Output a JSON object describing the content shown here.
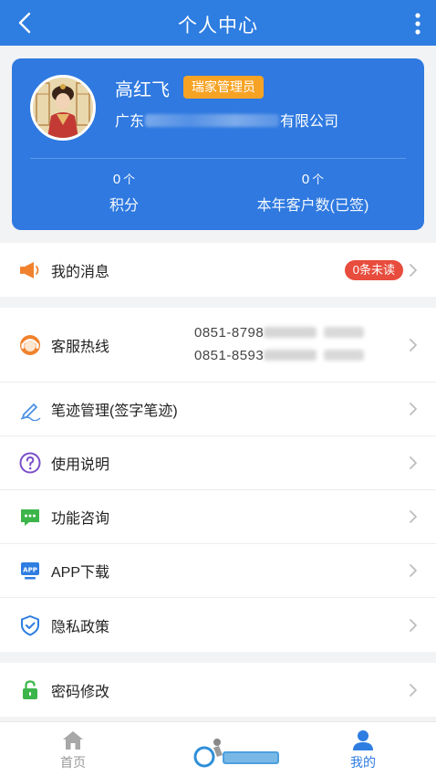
{
  "header": {
    "title": "个人中心"
  },
  "profile": {
    "name": "高红飞",
    "role": "瑞家管理员",
    "company_prefix": "广东",
    "company_suffix": "有限公司",
    "stats": [
      {
        "value": "0",
        "unit": "个",
        "label": "积分"
      },
      {
        "value": "0",
        "unit": "个",
        "label": "本年客户数(已签)"
      }
    ]
  },
  "menu": {
    "messages": {
      "label": "我的消息",
      "badge": "0条未读"
    },
    "hotline": {
      "label": "客服热线",
      "phone1": "0851-8798",
      "phone2": "0851-8593"
    },
    "signature": {
      "label": "笔迹管理(签字笔迹)"
    },
    "manual": {
      "label": "使用说明"
    },
    "consult": {
      "label": "功能咨询"
    },
    "download": {
      "label": "APP下载"
    },
    "privacy": {
      "label": "隐私政策"
    },
    "password": {
      "label": "密码修改"
    }
  },
  "tabs": {
    "home": "首页",
    "mine": "我的"
  },
  "colors": {
    "primary": "#2e7de1",
    "card": "#2f79e0",
    "badge": "#f6a325",
    "unread": "#e84c3d"
  }
}
